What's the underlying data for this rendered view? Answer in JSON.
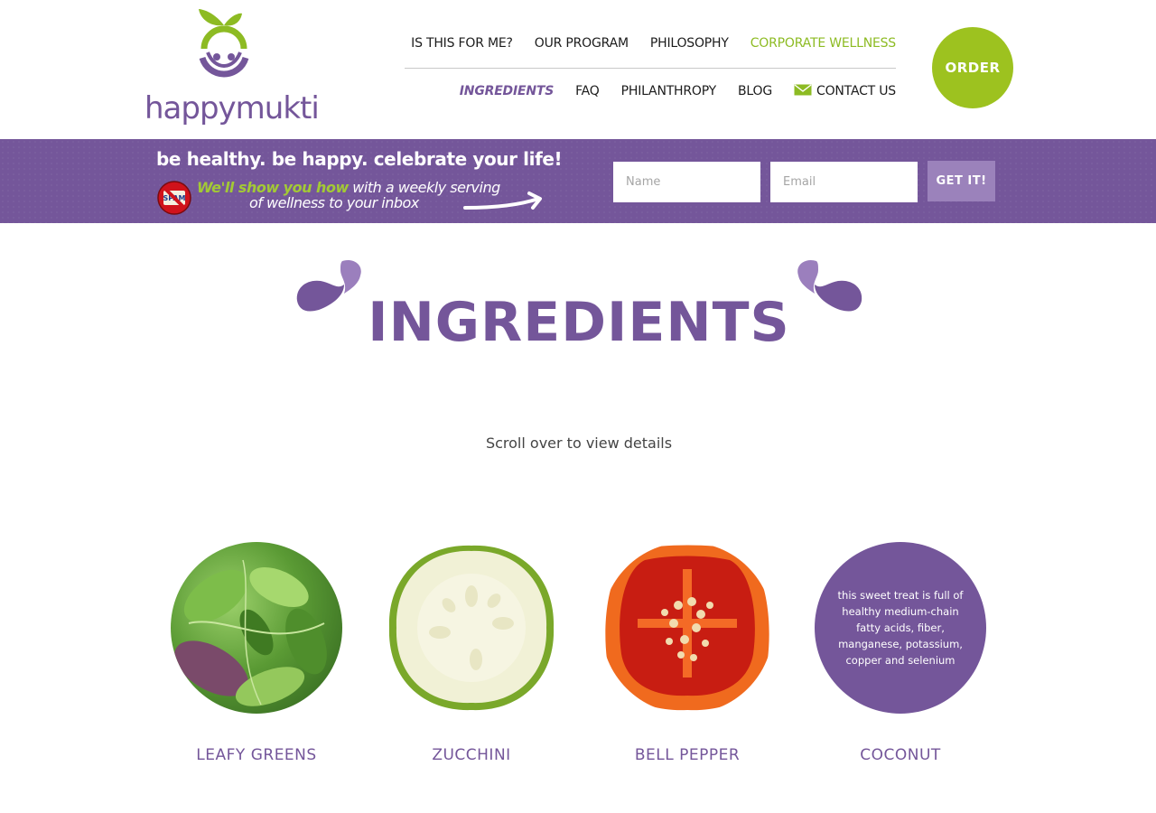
{
  "brand": {
    "logo_text": "happymukti",
    "primary_color": "#74569a",
    "accent_color": "#9dc21f"
  },
  "nav": {
    "top": [
      {
        "label": "IS THIS FOR ME?"
      },
      {
        "label": "OUR PROGRAM"
      },
      {
        "label": "PHILOSOPHY"
      },
      {
        "label": "CORPORATE WELLNESS"
      }
    ],
    "bottom": [
      {
        "label": "INGREDIENTS"
      },
      {
        "label": "FAQ"
      },
      {
        "label": "PHILANTHROPY"
      },
      {
        "label": "BLOG"
      },
      {
        "label": "CONTACT US",
        "icon": "mail-icon"
      }
    ],
    "order_label": "ORDER"
  },
  "banner": {
    "tagline": "be healthy. be happy. celebrate your life!",
    "promo_highlight": "We'll show you how",
    "promo_rest": " with a weekly serving",
    "promo_line2": "of wellness to your inbox",
    "name_placeholder": "Name",
    "email_placeholder": "Email",
    "submit_label": "GET IT!"
  },
  "main": {
    "title": "INGREDIENTS",
    "hint": "Scroll over to view details",
    "ingredients": [
      {
        "name": "LEAFY GREENS",
        "image": "leafy-greens-image"
      },
      {
        "name": "ZUCCHINI",
        "image": "zucchini-image"
      },
      {
        "name": "BELL PEPPER",
        "image": "bell-pepper-image"
      },
      {
        "name": "COCONUT",
        "description": "this sweet treat is full of healthy medium-chain fatty acids, fiber, manganese, potassium, copper and selenium"
      }
    ]
  }
}
